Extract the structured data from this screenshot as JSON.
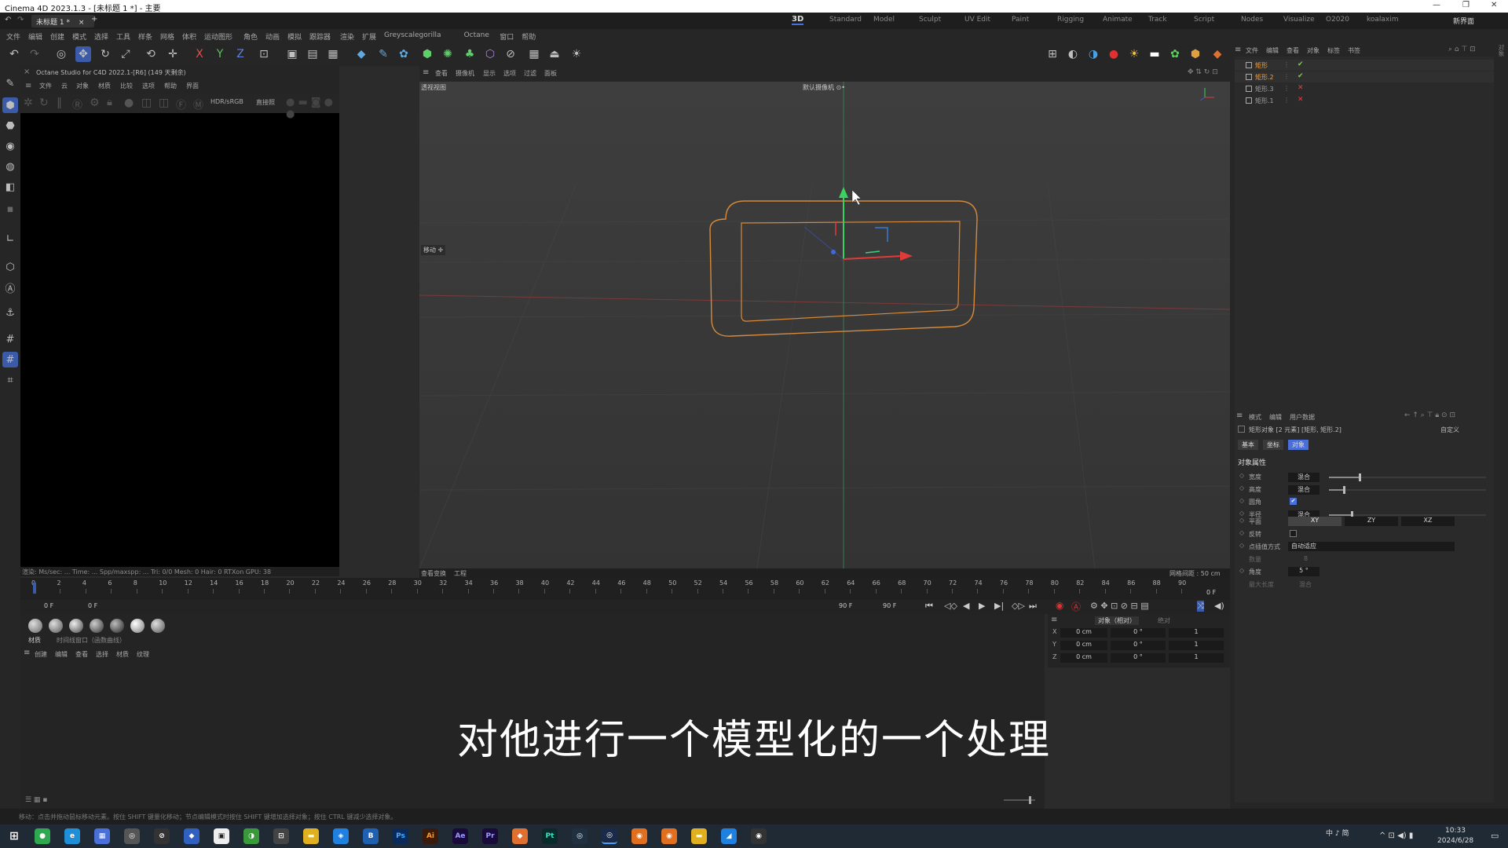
{
  "window": {
    "title": "Cinema 4D 2023.1.3 - [未标题 1 *] - 主要"
  },
  "tabs": {
    "doc": "未标题 1 *",
    "add": "+"
  },
  "workspaces": [
    "Standard",
    "Model",
    "Sculpt",
    "UV Edit",
    "Paint",
    "Rigging",
    "Animate",
    "Track",
    "Script",
    "Nodes",
    "Visualize",
    "O2020",
    "koalaxim",
    "新界面"
  ],
  "menu": [
    "文件",
    "编辑",
    "创建",
    "模式",
    "选择",
    "工具",
    "样条",
    "网格",
    "体积",
    "运动图形",
    "角色",
    "动画",
    "模拟",
    "跟踪器",
    "渲染",
    "扩展",
    "Greyscalegorilla",
    "Octane",
    "窗口",
    "帮助"
  ],
  "octane": {
    "title": "Octane Studio for C4D 2022.1-[R6] (149 天剩余)",
    "menu": [
      "文件",
      "云",
      "对象",
      "材质",
      "比较",
      "选项",
      "帮助",
      "界面"
    ],
    "colorspace": "HDR/sRGB",
    "mode": "直接照",
    "status": "渲染:   Ms/sec: ...   Time: ...   Spp/maxspp: ...   Tri: 0/0   Mesh: 0   Hair: 0   RTXon   GPU: 38"
  },
  "viewport": {
    "menu": [
      "查看",
      "摄像机",
      "显示",
      "选项",
      "过滤",
      "面板"
    ],
    "name": "透视视图",
    "camera": "默认摄像机 ⊙•",
    "move_label": "移动 ✛",
    "grid": "网格间距 : 50 cm",
    "foot_left": "查看变换",
    "foot_right": "工程"
  },
  "timeline": {
    "ticks": [
      "0",
      "2",
      "4",
      "6",
      "8",
      "10",
      "12",
      "14",
      "16",
      "18",
      "20",
      "22",
      "24",
      "26",
      "28",
      "30",
      "32",
      "34",
      "36",
      "38",
      "40",
      "42",
      "44",
      "46",
      "48",
      "50",
      "52",
      "54",
      "56",
      "58",
      "60",
      "62",
      "64",
      "66",
      "68",
      "70",
      "72",
      "74",
      "76",
      "78",
      "80",
      "82",
      "84",
      "86",
      "88",
      "90"
    ],
    "current": "0 F",
    "start": "0 F",
    "start2": "0 F",
    "end": "90 F",
    "end2": "90 F"
  },
  "materials": {
    "tabs": [
      "材质",
      "时间线窗口（函数曲线）"
    ],
    "menu": [
      "创建",
      "编辑",
      "查看",
      "选择",
      "材质",
      "纹理"
    ]
  },
  "coords": {
    "header": [
      "对象（相对）",
      "绝对"
    ],
    "rows": [
      {
        "axis": "X",
        "pos": "0 cm",
        "rot": "0 °",
        "scale": "1"
      },
      {
        "axis": "Y",
        "pos": "0 cm",
        "rot": "0 °",
        "scale": "1"
      },
      {
        "axis": "Z",
        "pos": "0 cm",
        "rot": "0 °",
        "scale": "1"
      }
    ]
  },
  "objects": {
    "menu": [
      "文件",
      "编辑",
      "查看",
      "对象",
      "标签",
      "书签"
    ],
    "items": [
      {
        "name": "矩形",
        "status": "check",
        "selected": true
      },
      {
        "name": "矩形.2",
        "status": "check",
        "selected": true
      },
      {
        "name": "矩形.3",
        "status": "cross",
        "selected": false
      },
      {
        "name": "矩形.1",
        "status": "cross",
        "selected": false
      }
    ]
  },
  "attributes": {
    "menu": [
      "模式",
      "编辑",
      "用户数据"
    ],
    "title": "矩形对象 [2 元素] [矩形, 矩形.2]",
    "preset": "自定义",
    "tabs": [
      "基本",
      "坐标",
      "对象"
    ],
    "section": "对象属性",
    "props": [
      {
        "label": "宽度",
        "value": "混合",
        "fill": 0.2
      },
      {
        "label": "高度",
        "value": "混合",
        "fill": 0.1
      },
      {
        "label": "圆角",
        "value": "",
        "fill": null
      },
      {
        "label": "半径",
        "value": "混合",
        "fill": 0.15
      }
    ],
    "plane_label": "平面",
    "planes": [
      "XY",
      "ZY",
      "XZ"
    ],
    "reverse_label": "反转",
    "interp_label": "点插值方式",
    "interp_value": "自动适应",
    "count_label": "数量",
    "count_value": "8",
    "angle_label": "角度",
    "angle_value": "5 °",
    "maxlen_label": "最大长度",
    "maxlen_value": "混合"
  },
  "status": "移动：点击并拖动鼠标移动元素。按住 SHIFT 键量化移动；节点编辑模式时按住 SHIFT 键增加选择对象；按住 CTRL 键减少选择对象。",
  "subtitle": "对他进行一个模型化的一个处理",
  "clock": {
    "time": "10:33",
    "date": "2024/6/28",
    "ime": "中 ♪ 简"
  },
  "colors": {
    "accent": "#4a6fd8",
    "spline": "#e09a3a",
    "axis_x": "#e03a3a",
    "axis_y": "#3ad060"
  }
}
